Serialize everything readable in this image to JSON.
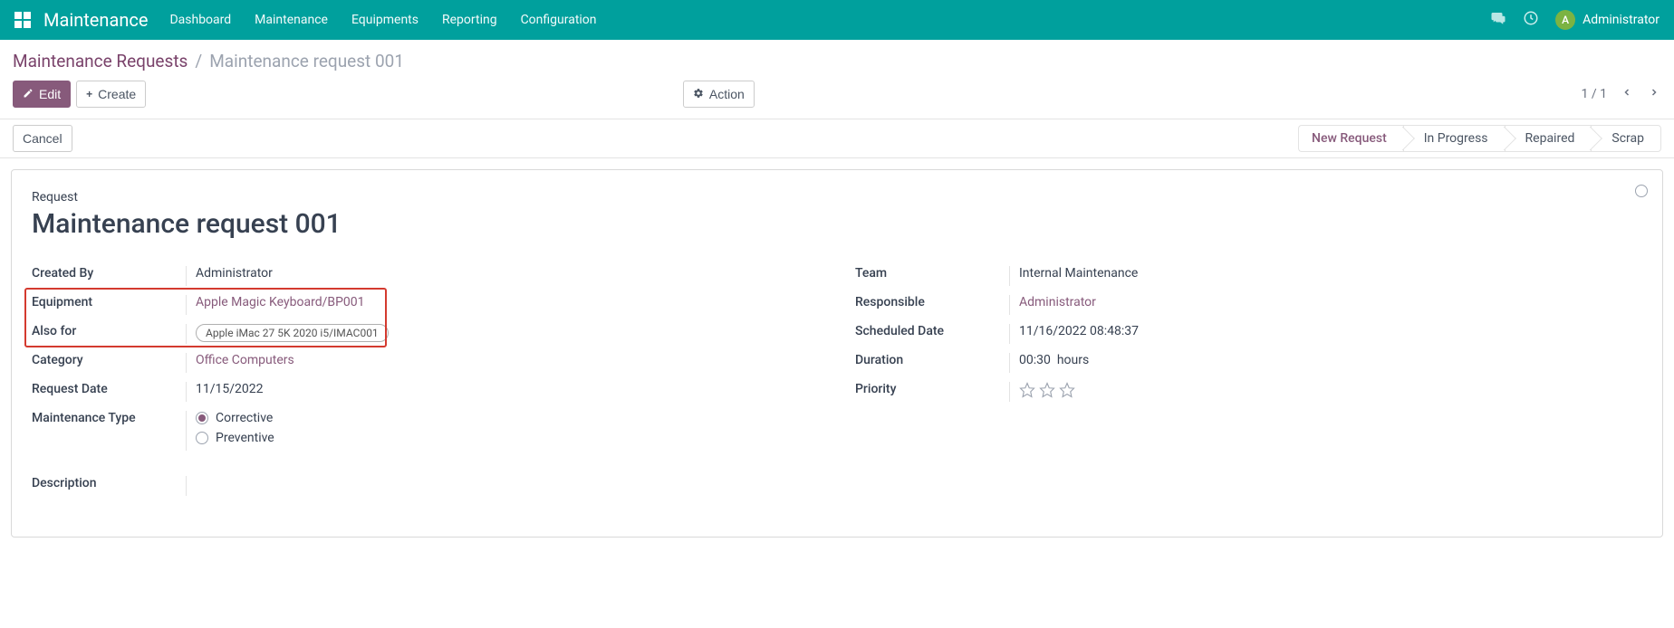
{
  "nav": {
    "app": "Maintenance",
    "items": [
      "Dashboard",
      "Maintenance",
      "Equipments",
      "Reporting",
      "Configuration"
    ],
    "user": {
      "initial": "A",
      "name": "Administrator"
    }
  },
  "breadcrumb": {
    "parent": "Maintenance Requests",
    "sep": "/",
    "current": "Maintenance request 001"
  },
  "toolbar": {
    "edit": "Edit",
    "create": "Create",
    "action": "Action",
    "pager": "1 / 1"
  },
  "statusbar": {
    "cancel": "Cancel",
    "stages": [
      "New Request",
      "In Progress",
      "Repaired",
      "Scrap"
    ],
    "active": 0
  },
  "form": {
    "request_label": "Request",
    "name": "Maintenance request 001",
    "left": {
      "created_by": {
        "label": "Created By",
        "value": "Administrator"
      },
      "equipment": {
        "label": "Equipment",
        "value": "Apple Magic Keyboard/BP001"
      },
      "also_for": {
        "label": "Also for",
        "tag": "Apple iMac 27 5K 2020 i5/IMAC001"
      },
      "category": {
        "label": "Category",
        "value": "Office Computers"
      },
      "request_date": {
        "label": "Request Date",
        "value": "11/15/2022"
      },
      "maintenance_type": {
        "label": "Maintenance Type",
        "opt1": "Corrective",
        "opt2": "Preventive"
      },
      "description": {
        "label": "Description"
      }
    },
    "right": {
      "team": {
        "label": "Team",
        "value": "Internal Maintenance"
      },
      "responsible": {
        "label": "Responsible",
        "value": "Administrator"
      },
      "scheduled_date": {
        "label": "Scheduled Date",
        "value": "11/16/2022 08:48:37"
      },
      "duration": {
        "label": "Duration",
        "value": "00:30",
        "unit": "hours"
      },
      "priority": {
        "label": "Priority"
      }
    }
  }
}
